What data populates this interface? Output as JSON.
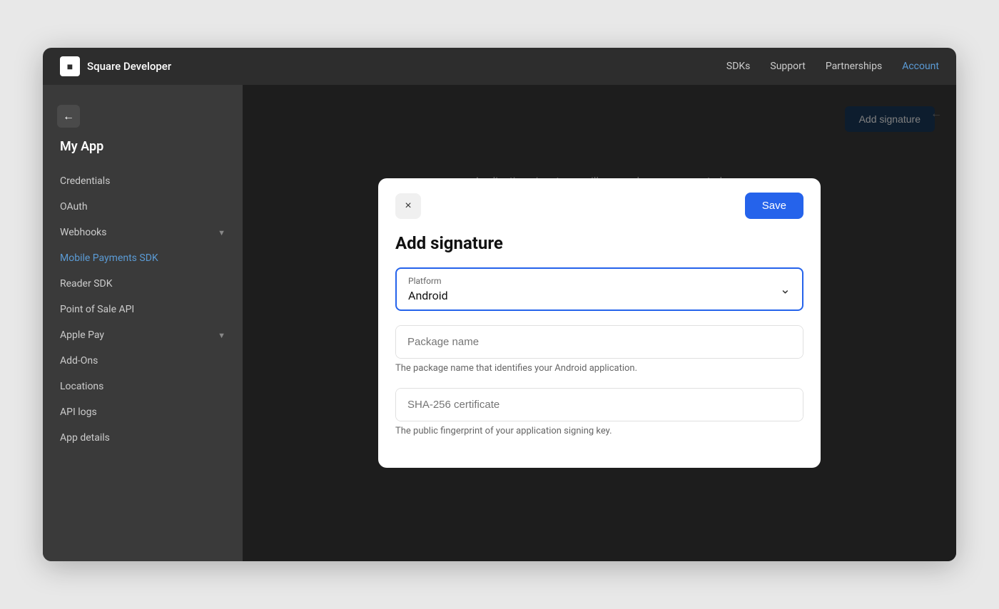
{
  "nav": {
    "logo_text": "Square Developer",
    "logo_icon": "■",
    "links": [
      {
        "label": "SDKs",
        "active": false
      },
      {
        "label": "Support",
        "active": false
      },
      {
        "label": "Partnerships",
        "active": false
      },
      {
        "label": "Account",
        "active": true
      }
    ]
  },
  "sidebar": {
    "app_name": "My App",
    "items": [
      {
        "label": "Credentials",
        "has_chevron": false,
        "active": false
      },
      {
        "label": "OAuth",
        "has_chevron": false,
        "active": false
      },
      {
        "label": "Webhooks",
        "has_chevron": true,
        "active": false
      },
      {
        "label": "Mobile Payments SDK",
        "has_chevron": false,
        "active": true
      },
      {
        "label": "Reader SDK",
        "has_chevron": false,
        "active": false
      },
      {
        "label": "Point of Sale API",
        "has_chevron": false,
        "active": false
      },
      {
        "label": "Apple Pay",
        "has_chevron": true,
        "active": false
      },
      {
        "label": "Add-Ons",
        "has_chevron": false,
        "active": false
      },
      {
        "label": "Locations",
        "has_chevron": false,
        "active": false
      },
      {
        "label": "API logs",
        "has_chevron": false,
        "active": false
      },
      {
        "label": "App details",
        "has_chevron": false,
        "active": false
      }
    ]
  },
  "content": {
    "add_signature_btn": "Add signature",
    "empty_state_text": "Application signatures will appear here once created.",
    "collapse_icon": "←"
  },
  "modal": {
    "title": "Add signature",
    "close_icon": "×",
    "save_label": "Save",
    "platform_label": "Platform",
    "platform_value": "Android",
    "package_name_placeholder": "Package name",
    "package_name_hint": "The package name that identifies your Android application.",
    "sha_placeholder": "SHA-256 certificate",
    "sha_hint": "The public fingerprint of your application signing key."
  }
}
